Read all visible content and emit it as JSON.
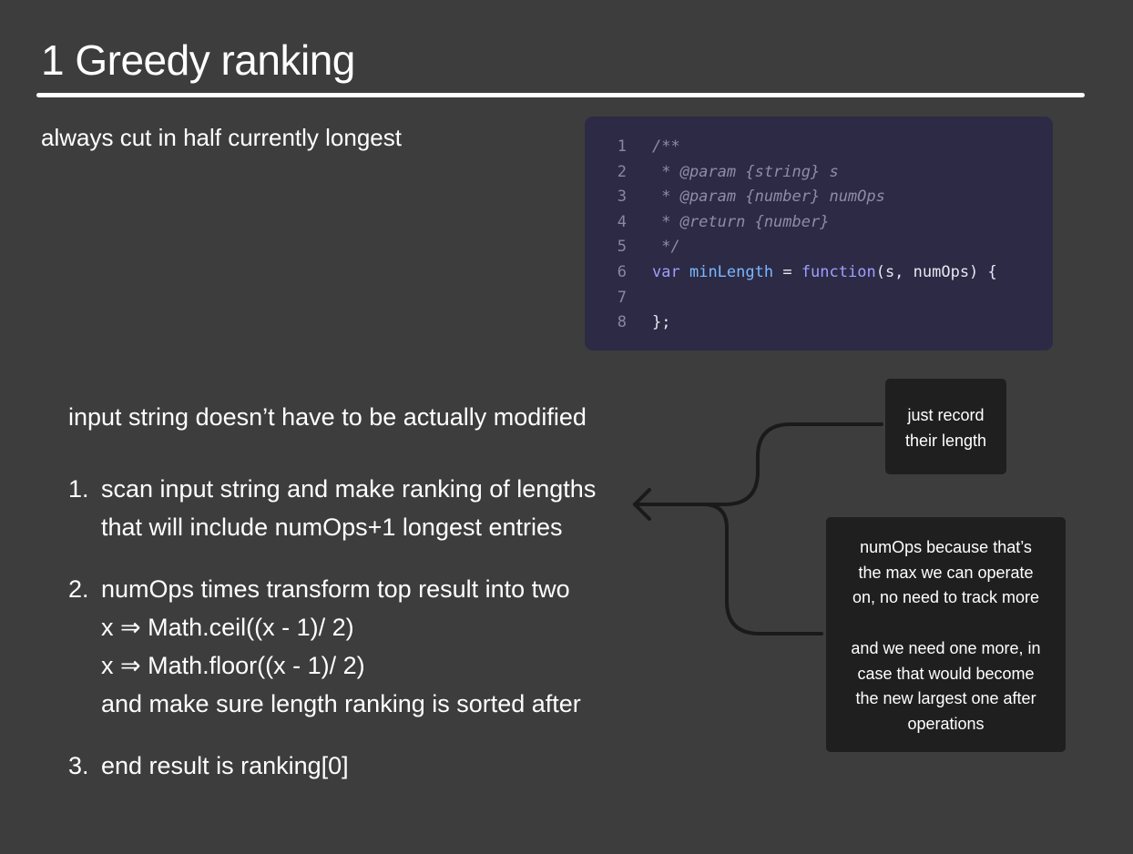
{
  "title": "1 Greedy ranking",
  "subtitle": "always cut in half currently longest",
  "code": {
    "lines": [
      {
        "number": "1",
        "text": "/**"
      },
      {
        "number": "2",
        "text": " * @param {string} s"
      },
      {
        "number": "3",
        "text": " * @param {number} numOps"
      },
      {
        "number": "4",
        "text": " * @return {number}"
      },
      {
        "number": "5",
        "text": " */"
      },
      {
        "number": "6",
        "text": "var minLength = function(s, numOps) {"
      },
      {
        "number": "7",
        "text": ""
      },
      {
        "number": "8",
        "text": "};"
      }
    ]
  },
  "intro": "input string doesn’t have to be actually modified",
  "steps": [
    {
      "number": "1.",
      "lines": [
        "scan input string and make ranking of lengths",
        "that will include numOps+1 longest entries"
      ]
    },
    {
      "number": "2.",
      "lines": [
        "numOps times transform top result into two",
        "x ⇒ Math.ceil((x - 1)/ 2)",
        "x ⇒ Math.floor((x - 1)/ 2)",
        "and make sure length ranking is sorted after"
      ]
    },
    {
      "number": "3.",
      "lines": [
        "end result is ranking[0]"
      ]
    }
  ],
  "notes": [
    {
      "lines": [
        "just record",
        "their length"
      ]
    },
    {
      "lines": [
        "numOps because that’s",
        "the max we can operate",
        "on, no need to track more",
        "",
        "and we need one more, in",
        "case that would become",
        "the new largest one after",
        "operations"
      ]
    }
  ],
  "colors": {
    "background": "#3d3d3d",
    "code_background": "#2d2a45",
    "note_background": "#1f1f1f",
    "connector": "#1a1a1a"
  }
}
